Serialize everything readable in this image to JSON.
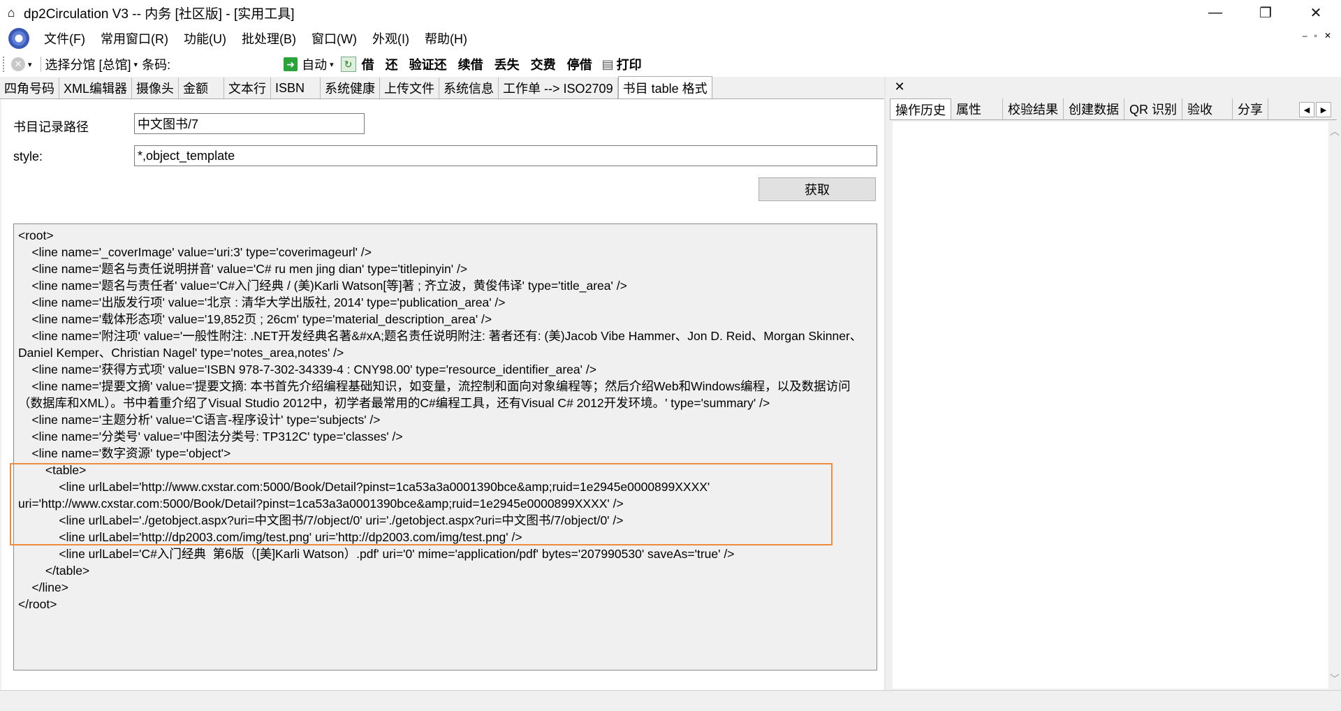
{
  "window": {
    "title": "dp2Circulation V3 -- 内务 [社区版] - [实用工具]",
    "minimize": "—",
    "maximize": "❐",
    "close": "✕"
  },
  "menu": {
    "items": [
      "文件(F)",
      "常用窗口(R)",
      "功能(U)",
      "批处理(B)",
      "窗口(W)",
      "外观(I)",
      "帮助(H)"
    ],
    "mdi_min": "–",
    "mdi_restore": "▫",
    "mdi_close": "✕"
  },
  "toolbar": {
    "branch_label": "选择分馆 [总馆]",
    "barcode_label": "条码:",
    "barcode_value": "",
    "auto_label": "自动",
    "buttons": [
      "借",
      "还",
      "验证还",
      "续借",
      "丢失",
      "交费",
      "停借"
    ],
    "print_label": "打印"
  },
  "left_tabs": [
    "四角号码",
    "XML编辑器",
    "摄像头",
    "金额",
    "文本行",
    "ISBN",
    "系统健康",
    "上传文件",
    "系统信息",
    "工作单 --> ISO2709",
    "书目 table 格式"
  ],
  "form": {
    "path_label": "书目记录路径",
    "path_value": "中文图书/7",
    "style_label": "style:",
    "style_value": "*,object_template",
    "fetch_button": "获取"
  },
  "xml_lines": [
    "<root>",
    "    <line name='_coverImage' value='uri:3' type='coverimageurl' />",
    "    <line name='题名与责任说明拼音' value='C# ru men jing dian' type='titlepinyin' />",
    "    <line name='题名与责任者' value='C#入门经典 / (美)Karli Watson[等]著 ; 齐立波，黄俊伟译' type='title_area' />",
    "    <line name='出版发行项' value='北京 : 清华大学出版社, 2014' type='publication_area' />",
    "    <line name='载体形态项' value='19,852页 ; 26cm' type='material_description_area' />",
    "    <line name='附注项' value='一般性附注: .NET开发经典名著&#xA;题名责任说明附注: 著者还有: (美)Jacob Vibe Hammer、Jon D. Reid、Morgan Skinner、Daniel Kemper、Christian Nagel' type='notes_area,notes' />",
    "    <line name='获得方式项' value='ISBN 978-7-302-34339-4 : CNY98.00' type='resource_identifier_area' />",
    "    <line name='提要文摘' value='提要文摘: 本书首先介绍编程基础知识，如变量，流控制和面向对象编程等；然后介绍Web和Windows编程，以及数据访问（数据库和XML）。书中着重介绍了Visual Studio 2012中，初学者最常用的C#编程工具，还有Visual C# 2012开发环境。' type='summary' />",
    "    <line name='主题分析' value='C语言-程序设计' type='subjects' />",
    "    <line name='分类号' value='中图法分类号: TP312C' type='classes' />",
    "    <line name='数字资源' type='object'>",
    "        <table>",
    "            <line urlLabel='http://www.cxstar.com:5000/Book/Detail?pinst=1ca53a3a0001390bce&amp;ruid=1e2945e0000899XXXX' uri='http://www.cxstar.com:5000/Book/Detail?pinst=1ca53a3a0001390bce&amp;ruid=1e2945e0000899XXXX' />",
    "            <line urlLabel='./getobject.aspx?uri=中文图书/7/object/0' uri='./getobject.aspx?uri=中文图书/7/object/0' />",
    "            <line urlLabel='http://dp2003.com/img/test.png' uri='http://dp2003.com/img/test.png' />",
    "            <line urlLabel='C#入门经典  第6版（[美]Karli Watson）.pdf' uri='0' mime='application/pdf' bytes='207990530' saveAs='true' />",
    "        </table>",
    "    </line>",
    "</root>"
  ],
  "right_tabs": [
    "操作历史",
    "属性",
    "校验结果",
    "创建数据",
    "QR 识别",
    "验收",
    "分享"
  ],
  "colors": {
    "highlight": "#f08a3c",
    "active_tab": "#ffffff"
  }
}
